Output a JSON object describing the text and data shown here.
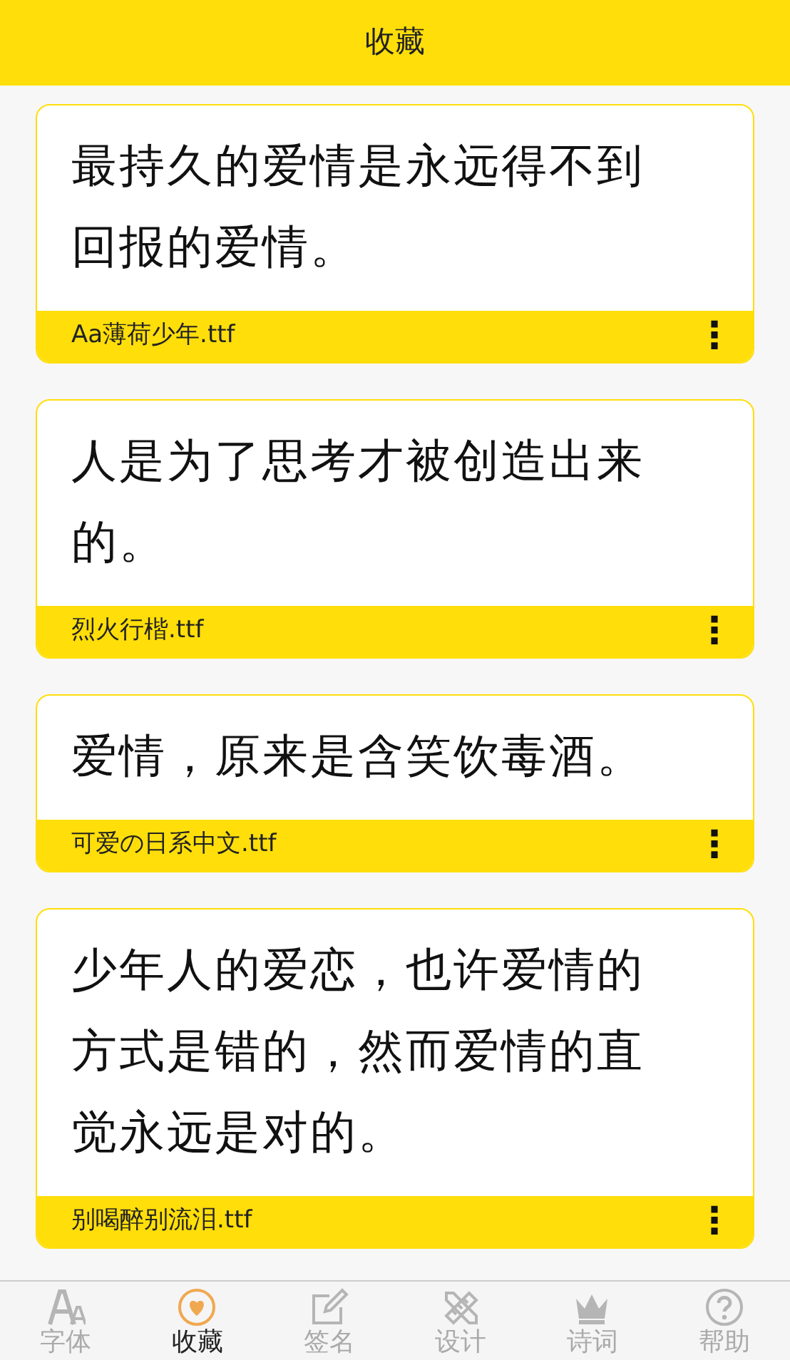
{
  "header": {
    "title": "收藏"
  },
  "favorites": [
    {
      "sample_lines": [
        "最持久的爱情是永远得不到",
        "回报的爱情。"
      ],
      "font_file": "Aa薄荷少年.ttf",
      "menu": "⋮"
    },
    {
      "sample_lines": [
        "人是为了思考才被创造出来",
        "的。"
      ],
      "font_file": "烈火行楷.ttf",
      "menu": "⋮"
    },
    {
      "sample_lines": [
        "爱情，原来是含笑饮毒酒。"
      ],
      "font_file": "可爱の日系中文.ttf",
      "menu": "⋮"
    },
    {
      "sample_lines": [
        "少年人的爱恋，也许爱情的",
        "方式是错的，然而爱情的直",
        "觉永远是对的。"
      ],
      "font_file": "别喝醉别流泪.ttf",
      "menu": "⋮"
    }
  ],
  "tabs": [
    {
      "label": "字体",
      "selected": false
    },
    {
      "label": "收藏",
      "selected": true
    },
    {
      "label": "签名",
      "selected": false
    },
    {
      "label": "设计",
      "selected": false
    },
    {
      "label": "诗词",
      "selected": false
    },
    {
      "label": "帮助",
      "selected": false
    }
  ]
}
